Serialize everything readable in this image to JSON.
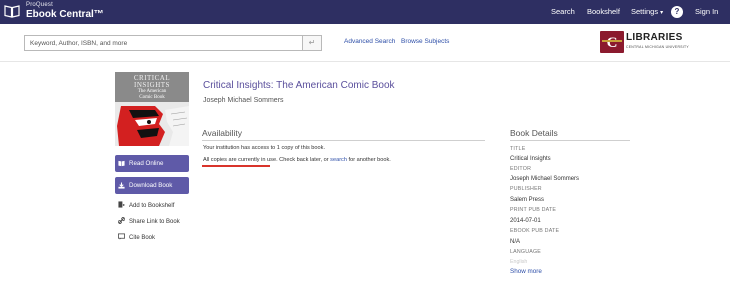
{
  "header": {
    "brand_small": "ProQuest",
    "brand_name": "Ebook Central™",
    "nav": {
      "search": "Search",
      "bookshelf": "Bookshelf",
      "settings": "Settings",
      "help": "?",
      "sign_in": "Sign In"
    }
  },
  "search": {
    "placeholder": "Keyword, Author, ISBN, and more",
    "submit_icon": "enter-arrow-icon",
    "advanced": "Advanced Search",
    "browse": "Browse Subjects"
  },
  "library": {
    "name": "LIBRARIES",
    "subtitle": "CENTRAL MICHIGAN UNIVERSITY"
  },
  "book": {
    "cover_line1": "CRITICAL",
    "cover_line2": "INSIGHTS",
    "cover_line3": "The American",
    "cover_line4": "Comic Book",
    "title": "Critical Insights: The American Comic Book",
    "author": "Joseph Michael Sommers"
  },
  "actions": {
    "read_online": "Read Online",
    "download": "Download Book",
    "add_bookshelf": "Add to Bookshelf",
    "share": "Share Link to Book",
    "cite": "Cite Book"
  },
  "availability": {
    "heading": "Availability",
    "access": "Your institution has access to 1 copy of this book.",
    "in_use": "All copies are currently in use.",
    "check_back": " Check back later, or ",
    "search_link": "search",
    "another": " for another book."
  },
  "details": {
    "heading": "Book Details",
    "title_label": "TITLE",
    "title_value": "Critical Insights",
    "editor_label": "EDITOR",
    "editor_value": "Joseph Michael Sommers",
    "publisher_label": "PUBLISHER",
    "publisher_value": "Salem Press",
    "print_date_label": "PRINT PUB DATE",
    "print_date_value": "2014-07-01",
    "ebook_date_label": "EBOOK PUB DATE",
    "ebook_date_value": "N/A",
    "language_label": "LANGUAGE",
    "language_value": "English",
    "show_more": "Show more"
  },
  "colors": {
    "navbar": "#2e2f62",
    "button": "#5f5aa8",
    "title": "#5a4f9c",
    "link": "#2e4fa8",
    "highlight": "#d9342b"
  }
}
